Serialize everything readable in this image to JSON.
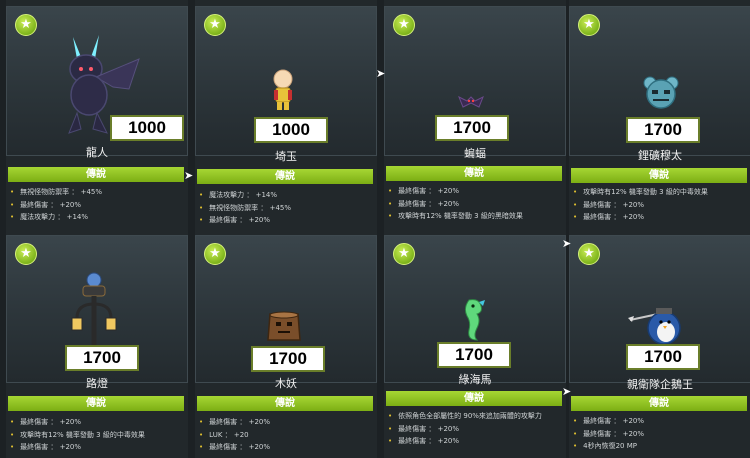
{
  "star_glyph": "★",
  "cards": [
    {
      "price": "1000",
      "name": "龍人",
      "tier": "傳說",
      "stats": [
        "無視怪物防禦率 ： +45%",
        "最終傷害 ： +20%",
        "魔法攻擊力 ： +14%"
      ]
    },
    {
      "price": "1000",
      "name": "埼玉",
      "tier": "傳說",
      "stats": [
        "魔法攻擊力 ： +14%",
        "無視怪物防禦率 ： +45%",
        "最終傷害 ： +20%"
      ]
    },
    {
      "price": "1700",
      "name": "蝙蝠",
      "tier": "傳說",
      "stats": [
        "最終傷害 ： +20%",
        "最終傷害 ： +20%",
        "攻擊時有12% 機率發動 3 級的黑暗效果"
      ]
    },
    {
      "price": "1700",
      "name": "鋰礦穆太",
      "tier": "傳說",
      "stats": [
        "攻擊時有12% 機率發動 3 級的中毒效果",
        "最終傷害 ： +20%",
        "最終傷害 ： +20%"
      ]
    },
    {
      "price": "1700",
      "name": "路燈",
      "tier": "傳說",
      "stats": [
        "最終傷害 ： +20%",
        "攻擊時有12% 機率發動 3 級的中毒效果",
        "最終傷害 ： +20%"
      ]
    },
    {
      "price": "1700",
      "name": "木妖",
      "tier": "傳說",
      "stats": [
        "最終傷害 ： +20%",
        "LUK ： +20",
        "最終傷害 ： +20%"
      ]
    },
    {
      "price": "1700",
      "name": "綠海馬",
      "tier": "傳說",
      "stats": [
        "依照角色全部屬性的 90%來追加兩體的攻擊力",
        "最終傷害 ： +20%",
        "最終傷害 ： +20%"
      ]
    },
    {
      "price": "1700",
      "name": "親衛隊企鵝王",
      "tier": "傳說",
      "stats": [
        "最終傷害 ： +20%",
        "最終傷害 ： +20%",
        "4秒內恢復20 MP"
      ]
    }
  ]
}
